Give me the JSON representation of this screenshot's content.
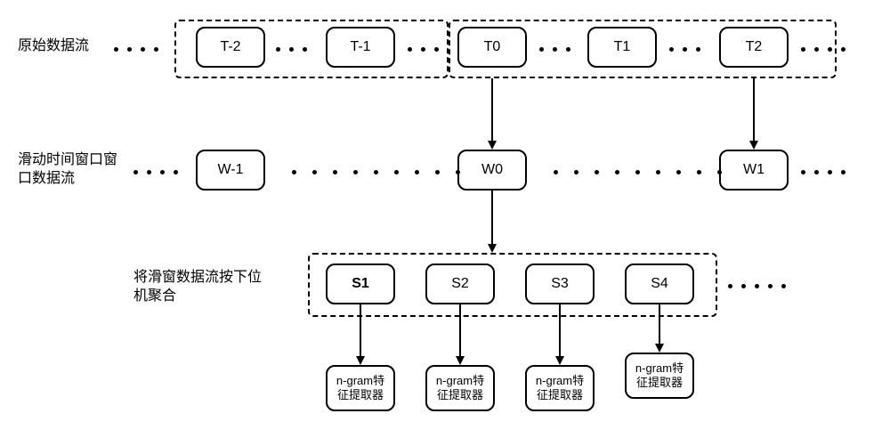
{
  "labels": {
    "row1": "原始数据流",
    "row2": "滑动时间窗口窗\n口数据流",
    "row3": "将滑窗数据流按下位\n机聚合"
  },
  "row1": {
    "tm2": "T-2",
    "tm1": "T-1",
    "t0": "T0",
    "t1": "T1",
    "t2": "T2"
  },
  "row2": {
    "wm1": "W-1",
    "w0": "W0",
    "w1": "W1"
  },
  "row3": {
    "s1": "S1",
    "s2": "S2",
    "s3": "S3",
    "s4": "S4"
  },
  "extractor": "n-gram特\n征提取器"
}
